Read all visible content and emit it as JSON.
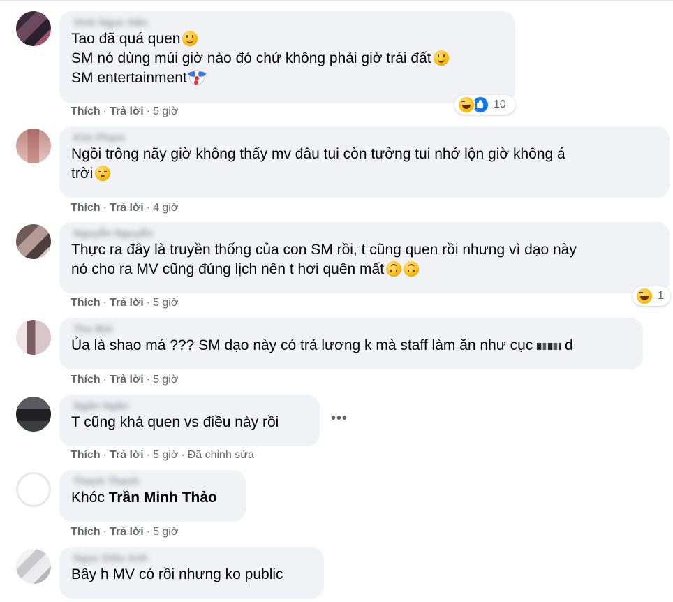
{
  "comments": [
    {
      "author": "Vinh Ngọc Hân",
      "lines": [
        "Tao đã quá quen",
        "SM nó dùng múi giờ nào đó chứ không phải giờ trái đất",
        "SM entertainment"
      ],
      "emojis": [
        "slightly-smiling-face",
        "slightly-smiling-face",
        "clown-face"
      ],
      "actions": {
        "like": "Thích",
        "reply": "Trả lời",
        "time": "5 giờ"
      },
      "reactions": {
        "icons": [
          "haha-reaction",
          "like-reaction"
        ],
        "count": "10"
      }
    },
    {
      "author": "Kim Phạm",
      "lines": [
        "Ngồi trông nãy giờ không thấy mv đâu tui còn tưởng tui nhớ lộn giờ không á",
        "trời"
      ],
      "emojis": [
        "pensive-face"
      ],
      "actions": {
        "like": "Thích",
        "reply": "Trả lời",
        "time": "4 giờ"
      }
    },
    {
      "author": "Nguyễn Nguyễn",
      "lines": [
        "Thực ra đây là truyền thống của con SM rồi, t cũng quen rồi nhưng vì dạo này",
        "nó cho ra MV cũng đúng lịch nên t hơi quên mất"
      ],
      "emojis": [
        "upside-down-face",
        "upside-down-face"
      ],
      "actions": {
        "like": "Thích",
        "reply": "Trả lời",
        "time": "5 giờ"
      },
      "reactions": {
        "icons": [
          "haha-reaction"
        ],
        "count": "1"
      }
    },
    {
      "author": "Thu Bùi",
      "lines": [
        "Ủa là shao má ??? SM dạo này có trả lương k mà staff làm ăn như cục",
        "d"
      ],
      "actions": {
        "like": "Thích",
        "reply": "Trả lời",
        "time": "5 giờ"
      }
    },
    {
      "author": "Ngân Ngân",
      "lines": [
        "T cũng khá quen vs điều này rồi"
      ],
      "actions": {
        "like": "Thích",
        "reply": "Trả lời",
        "time": "5 giờ",
        "edited": "Đã chỉnh sửa"
      },
      "more": "•••"
    },
    {
      "author": "Thanh Thanh",
      "lines": [
        "Khóc",
        "Trần Minh Thảo"
      ],
      "actions": {
        "like": "Thích",
        "reply": "Trả lời",
        "time": "5 giờ"
      }
    },
    {
      "author": "Ngọc Diệu Anh",
      "lines": [
        "Bây h MV có rồi nhưng ko public"
      ]
    }
  ],
  "colors": {
    "bubble": "#f0f2f5",
    "meta": "#65676b",
    "like_blue": "#1877f2",
    "text": "#050505"
  }
}
